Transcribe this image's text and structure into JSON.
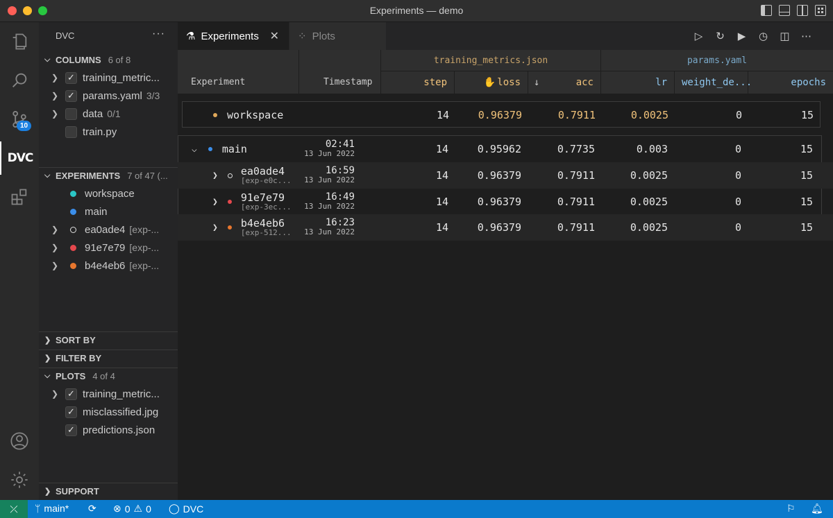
{
  "window": {
    "title": "Experiments — demo"
  },
  "activity_bar": {
    "source_control_badge": "10",
    "dvc_label": "DVC"
  },
  "sidebar": {
    "title": "DVC",
    "more_label": "···",
    "columns": {
      "header": "COLUMNS",
      "count": "6 of 8",
      "items": [
        {
          "label": "training_metric...",
          "sub": "",
          "checked": true
        },
        {
          "label": "params.yaml",
          "sub": "3/3",
          "checked": true
        },
        {
          "label": "data",
          "sub": "0/1",
          "checked": false
        },
        {
          "label": "train.py",
          "sub": "",
          "checked": false
        }
      ]
    },
    "experiments": {
      "header": "EXPERIMENTS",
      "count": "7 of 47 (...",
      "items": [
        {
          "label": "workspace",
          "sub": "",
          "color": "#2bc6c6"
        },
        {
          "label": "main",
          "sub": "",
          "color": "#3b8eea"
        },
        {
          "label": "ea0ade4",
          "sub": "[exp-...",
          "color": "ring"
        },
        {
          "label": "91e7e79",
          "sub": "[exp-...",
          "color": "#e5484d"
        },
        {
          "label": "b4e4eb6",
          "sub": "[exp-...",
          "color": "#e8772e"
        }
      ]
    },
    "sort_by": "SORT BY",
    "filter_by": "FILTER BY",
    "plots": {
      "header": "PLOTS",
      "count": "4 of 4",
      "items": [
        {
          "label": "training_metric..."
        },
        {
          "label": "misclassified.jpg"
        },
        {
          "label": "predictions.json"
        }
      ]
    },
    "support": "SUPPORT"
  },
  "tabs": {
    "experiments": "Experiments",
    "plots": "Plots"
  },
  "table": {
    "groups": {
      "metrics": "training_metrics.json",
      "params": "params.yaml"
    },
    "columns": {
      "experiment": "Experiment",
      "timestamp": "Timestamp",
      "step": "step",
      "loss": "loss",
      "acc": "acc",
      "lr": "lr",
      "weight_decay": "weight_de...",
      "epochs": "epochs"
    },
    "workspace": {
      "name": "workspace",
      "step": "14",
      "loss": "0.96379",
      "acc": "0.7911",
      "lr": "0.0025",
      "weight_decay": "0",
      "epochs": "15"
    },
    "main": {
      "name": "main",
      "time": "02:41",
      "date": "13 Jun 2022",
      "step": "14",
      "loss": "0.95962",
      "acc": "0.7735",
      "lr": "0.003",
      "weight_decay": "0",
      "epochs": "15"
    },
    "experiments": [
      {
        "name": "ea0ade4",
        "sub": "[exp-e0c...",
        "time": "16:59",
        "date": "13 Jun 2022",
        "step": "14",
        "loss": "0.96379",
        "acc": "0.7911",
        "lr": "0.0025",
        "weight_decay": "0",
        "epochs": "15"
      },
      {
        "name": "91e7e79",
        "sub": "[exp-3ec...",
        "time": "16:49",
        "date": "13 Jun 2022",
        "step": "14",
        "loss": "0.96379",
        "acc": "0.7911",
        "lr": "0.0025",
        "weight_decay": "0",
        "epochs": "15"
      },
      {
        "name": "b4e4eb6",
        "sub": "[exp-512...",
        "time": "16:23",
        "date": "13 Jun 2022",
        "step": "14",
        "loss": "0.96379",
        "acc": "0.7911",
        "lr": "0.0025",
        "weight_decay": "0",
        "epochs": "15"
      }
    ]
  },
  "status_bar": {
    "branch": "main*",
    "errors": "0",
    "warnings": "0",
    "dvc": "DVC"
  }
}
